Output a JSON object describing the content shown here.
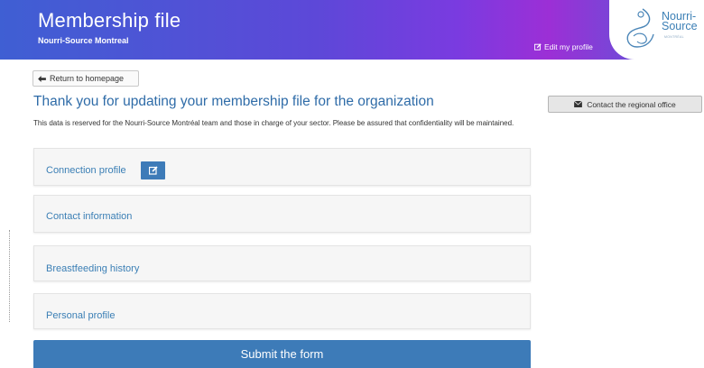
{
  "header": {
    "title": "Membership file",
    "subtitle": "Nourri-Source Montreal",
    "edit_profile_label": "Edit my profile",
    "logo_line1": "Nourri-",
    "logo_line2": "Source",
    "logo_small": "MONTRÉAL",
    "colors": {
      "gradient_start": "#3f5fd3",
      "gradient_mid": "#7a3be0",
      "gradient_end": "#4a63d8",
      "logo_blue": "#3b7fb5"
    }
  },
  "nav": {
    "return_label": "Return to homepage",
    "return_icon": "arrow-left-icon"
  },
  "main": {
    "title": "Thank you for updating your membership file for the organization",
    "intro": "This data is reserved for the Nourri-Source Montréal team and those in charge of your sector. Please be assured that confidentiality will be maintained.",
    "sections": [
      {
        "label": "Connection profile",
        "has_edit": true
      },
      {
        "label": "Contact information",
        "has_edit": false
      },
      {
        "label": "Breastfeeding history",
        "has_edit": false
      },
      {
        "label": "Personal profile",
        "has_edit": false
      }
    ],
    "submit_label": "Submit the form",
    "accent_color": "#3d7bb8"
  },
  "sidebar": {
    "contact_label": "Contact the regional office",
    "contact_icon": "envelope-icon"
  }
}
